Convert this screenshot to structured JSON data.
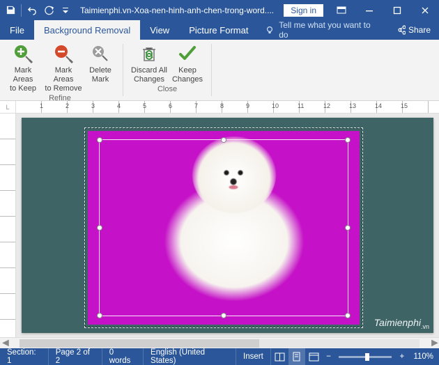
{
  "titlebar": {
    "document_title": "Taimienphi.vn-Xoa-nen-hinh-anh-chen-trong-word....",
    "signin_label": "Sign in"
  },
  "tabs": {
    "file": "File",
    "bg_removal": "Background Removal",
    "view": "View",
    "picture_format": "Picture Format",
    "tell_me": "Tell me what you want to do",
    "share": "Share"
  },
  "ribbon": {
    "mark_keep_l1": "Mark Areas",
    "mark_keep_l2": "to Keep",
    "mark_remove_l1": "Mark Areas",
    "mark_remove_l2": "to Remove",
    "delete_l1": "Delete",
    "delete_l2": "Mark",
    "discard_l1": "Discard All",
    "discard_l2": "Changes",
    "keep_l1": "Keep",
    "keep_l2": "Changes",
    "group_refine": "Refine",
    "group_close": "Close"
  },
  "ruler": {
    "corner": "L"
  },
  "watermark": {
    "brand": "Taimienphi",
    "suffix": ".vn"
  },
  "status": {
    "section": "Section: 1",
    "page": "Page 2 of 2",
    "words": "0 words",
    "language": "English (United States)",
    "mode": "Insert",
    "zoom": "110%"
  }
}
